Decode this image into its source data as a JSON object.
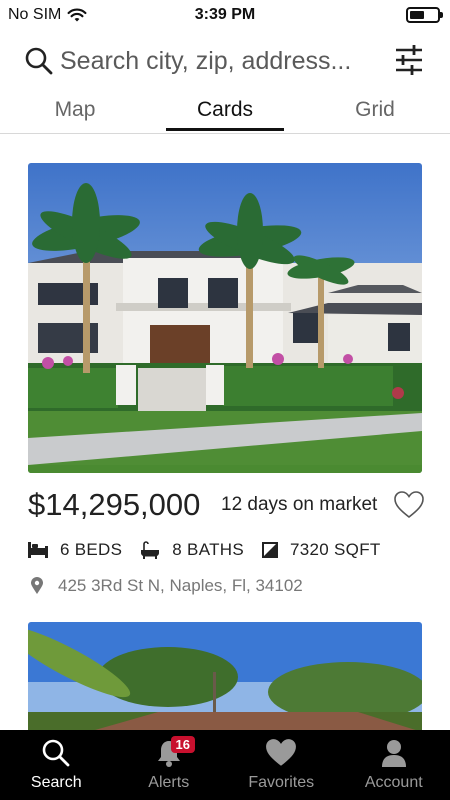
{
  "status_bar": {
    "carrier": "No SIM",
    "time": "3:39 PM",
    "battery_level": 0.55,
    "icons": [
      "wifi-icon",
      "battery-icon"
    ]
  },
  "search": {
    "placeholder": "Search city, zip, address...",
    "value": "",
    "icons": [
      "search-icon",
      "filter-sliders-icon"
    ]
  },
  "tabs": [
    {
      "label": "Map",
      "active": false
    },
    {
      "label": "Cards",
      "active": true
    },
    {
      "label": "Grid",
      "active": false
    }
  ],
  "listings": [
    {
      "price": "$14,295,000",
      "days_on_market": "12 days on market",
      "beds": "6 BEDS",
      "baths": "8 BATHS",
      "sqft": "7320 SQFT",
      "address": "425 3Rd St N, Naples, Fl, 34102",
      "favorited": false
    }
  ],
  "bottom_nav": [
    {
      "label": "Search",
      "icon": "search-icon",
      "active": true
    },
    {
      "label": "Alerts",
      "icon": "bell-icon",
      "active": false,
      "badge": "16"
    },
    {
      "label": "Favorites",
      "icon": "heart-icon",
      "active": false
    },
    {
      "label": "Account",
      "icon": "person-icon",
      "active": false
    }
  ],
  "colors": {
    "accent": "#111111",
    "nav_background": "#000000",
    "badge": "#c8102e",
    "muted_text": "#777777"
  }
}
